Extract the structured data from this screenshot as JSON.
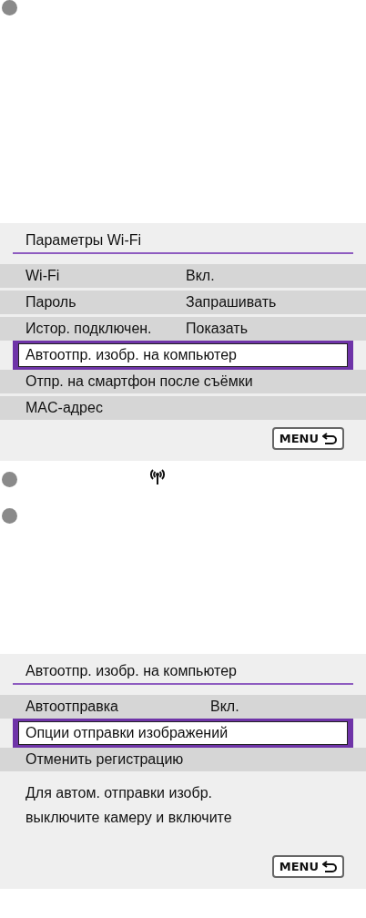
{
  "screens": [
    {
      "title": "Параметры Wi-Fi",
      "rows": [
        {
          "label": "Wi-Fi",
          "value": "Вкл.",
          "selected": false
        },
        {
          "label": "Пароль",
          "value": "Запрашивать",
          "selected": false
        },
        {
          "label": "Истор. подключен.",
          "value": "Показать",
          "selected": false
        },
        {
          "label": "Автоотпр. изобр. на компьютер",
          "selected": true
        },
        {
          "label": "Отпр. на смартфон после съёмки",
          "selected": false
        },
        {
          "label": "MAC-адрес",
          "selected": false
        }
      ],
      "menu_button": "MENU"
    },
    {
      "title": "Автоотпр. изобр. на компьютер",
      "rows": [
        {
          "label": "Автоотправка",
          "value": "Вкл.",
          "selected": false
        },
        {
          "label": "Опции отправки изображений",
          "selected": true
        },
        {
          "label": "Отменить регистрацию",
          "selected": false
        }
      ],
      "message": [
        "Для автом. отправки изобр.",
        "выключите камеру и включите"
      ],
      "menu_button": "MENU"
    }
  ]
}
